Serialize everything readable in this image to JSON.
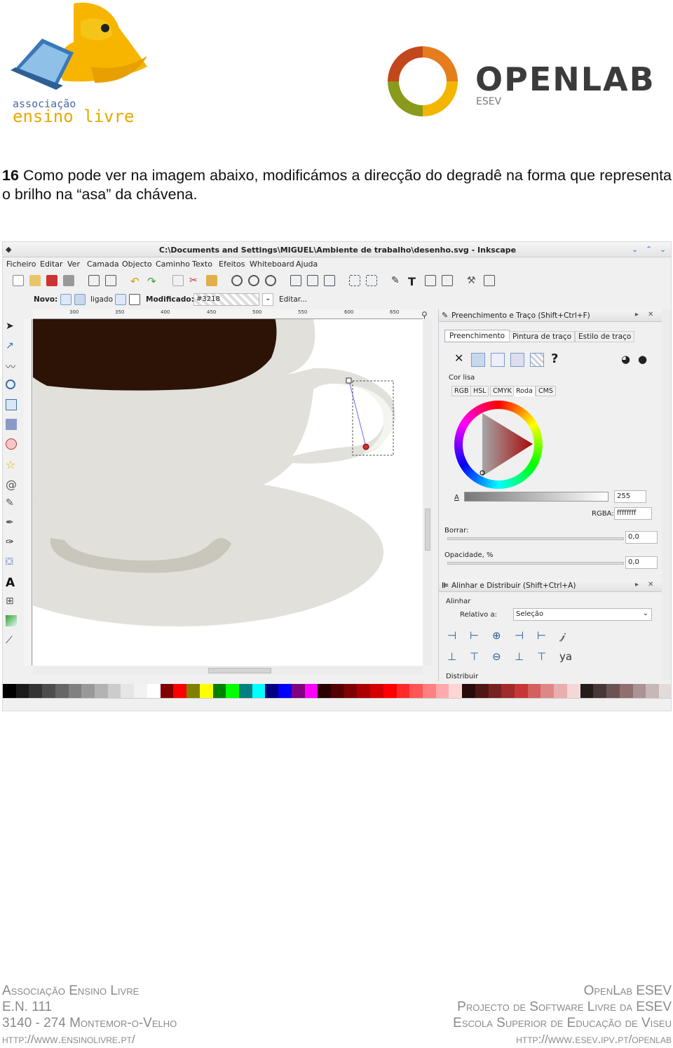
{
  "header": {
    "left_logo": {
      "line1": "associação",
      "line2": "ensino livre"
    },
    "right_logo": {
      "brand": "OPENLAB",
      "sub": "ESEV"
    }
  },
  "intro": {
    "number": "16",
    "text": " Como pode ver na imagem abaixo, modificámos a direcção do degradê na forma que representa o brilho na “asa” da chávena."
  },
  "window": {
    "title": "C:\\Documents and Settings\\MIGUEL\\Ambiente de trabalho\\desenho.svg - Inkscape",
    "menu": [
      "Ficheiro",
      "Editar",
      "Ver",
      "Camada",
      "Objecto",
      "Caminho",
      "Texto",
      "Efeitos",
      "Whiteboard",
      "Ajuda"
    ],
    "controls": {
      "new_label": "Novo:",
      "linked_label": "ligado",
      "modified_label": "Modificado:",
      "gradient_id": "#3218",
      "edit_label": "Editar..."
    },
    "ruler_labels": [
      "300",
      "350",
      "400",
      "450",
      "500",
      "550",
      "600",
      "650"
    ],
    "fill_panel": {
      "title": "Preenchimento e Traço (Shift+Ctrl+F)",
      "tabs": [
        "Preenchimento",
        "Pintura de traço",
        "Estilo de traço"
      ],
      "flat_color_label": "Cor lisa",
      "color_modes": [
        "RGB",
        "HSL",
        "CMYK",
        "Roda",
        "CMS"
      ],
      "alpha_label": "A",
      "alpha_value": "255",
      "rgba_label": "RGBA:",
      "rgba_value": "ffffffff",
      "blur_label": "Borrar:",
      "blur_value": "0,0",
      "opacity_label": "Opacidade, %",
      "opacity_value": "0,0"
    },
    "align_panel": {
      "title": "Alinhar e Distribuir (Shift+Ctrl+A)",
      "align_label": "Alinhar",
      "relative_label": "Relativo a:",
      "relative_value": "Seleção",
      "distribute_label": "Distribuir"
    },
    "palette": [
      "#000000",
      "#1a1a1a",
      "#333333",
      "#4d4d4d",
      "#666666",
      "#808080",
      "#999999",
      "#b3b3b3",
      "#cccccc",
      "#e6e6e6",
      "#f2f2f2",
      "#ffffff",
      "#800000",
      "#ff0000",
      "#808000",
      "#ffff00",
      "#008000",
      "#00ff00",
      "#008080",
      "#00ffff",
      "#000080",
      "#0000ff",
      "#800080",
      "#ff00ff",
      "#2b0000",
      "#550000",
      "#800000",
      "#aa0000",
      "#d40000",
      "#ff0000",
      "#ff2a2a",
      "#ff5555",
      "#ff8080",
      "#ffaaaa",
      "#ffd5d5",
      "#280b0b",
      "#501616",
      "#782121",
      "#a02c2c",
      "#c83737",
      "#d35f5f",
      "#de8787",
      "#e9afaf",
      "#f4d7d7",
      "#241c1c",
      "#483737",
      "#6c5353",
      "#916f6f",
      "#ac9393",
      "#c8b7b7",
      "#e3dbdb"
    ]
  },
  "footer": {
    "left": [
      "Associação Ensino Livre",
      "E.N. 111",
      "3140 - 274 Montemor-o-Velho",
      "http://www.ensinolivre.pt/"
    ],
    "right": [
      "OpenLab ESEV",
      "Projecto de Software Livre da ESEV",
      "Escola Superior de Educação de Viseu",
      "http://www.esev.ipv.pt/openlab"
    ]
  }
}
